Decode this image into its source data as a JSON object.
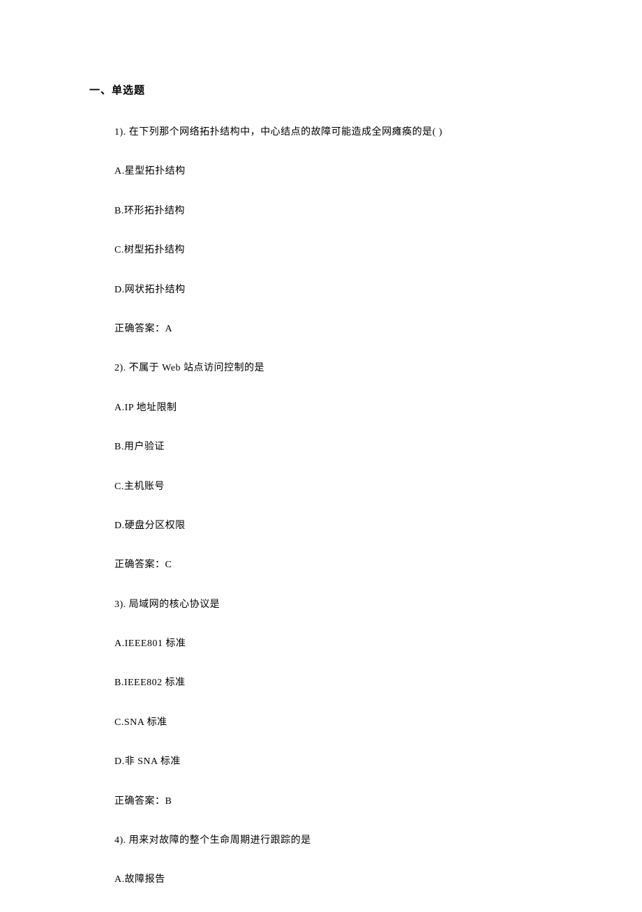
{
  "section_title": "一、单选题",
  "questions": [
    {
      "number": "1). 在下列那个网络拓扑结构中，中心结点的故障可能造成全网瘫痪的是( )",
      "options": [
        "A.星型拓扑结构",
        "B.环形拓扑结构",
        "C.树型拓扑结构",
        "D.网状拓扑结构"
      ],
      "answer": "正确答案：A"
    },
    {
      "number": "2). 不属于 Web 站点访问控制的是",
      "options": [
        "A.IP 地址限制",
        "B.用户验证",
        "C.主机账号",
        "D.硬盘分区权限"
      ],
      "answer": "正确答案：C"
    },
    {
      "number": "3). 局域网的核心协议是",
      "options": [
        "A.IEEE801 标准",
        "B.IEEE802 标准",
        "C.SNA 标准",
        "D.非 SNA 标准"
      ],
      "answer": "正确答案：B"
    },
    {
      "number": "4). 用来对故障的整个生命周期进行跟踪的是",
      "options": [
        "A.故障报告"
      ],
      "answer": ""
    }
  ]
}
